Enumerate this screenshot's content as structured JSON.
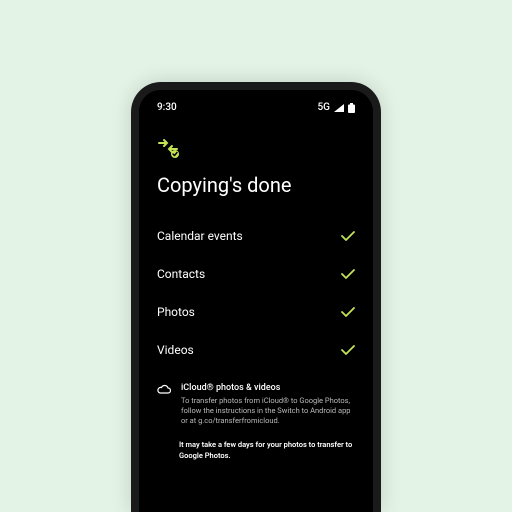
{
  "status": {
    "time": "9:30",
    "network": "5G"
  },
  "header": {
    "title": "Copying's done"
  },
  "items": [
    {
      "label": "Calendar events"
    },
    {
      "label": "Contacts"
    },
    {
      "label": "Photos"
    },
    {
      "label": "Videos"
    }
  ],
  "cloud": {
    "title": "iCloud® photos & videos",
    "body": "To transfer photos from iCloud® to Google Photos, follow the instructions in the Switch to Android app or at g.co/transferfromicloud."
  },
  "footer": {
    "note": "It may take a few days for your photos to transfer to Google Photos."
  },
  "colors": {
    "accent": "#c4e456"
  }
}
